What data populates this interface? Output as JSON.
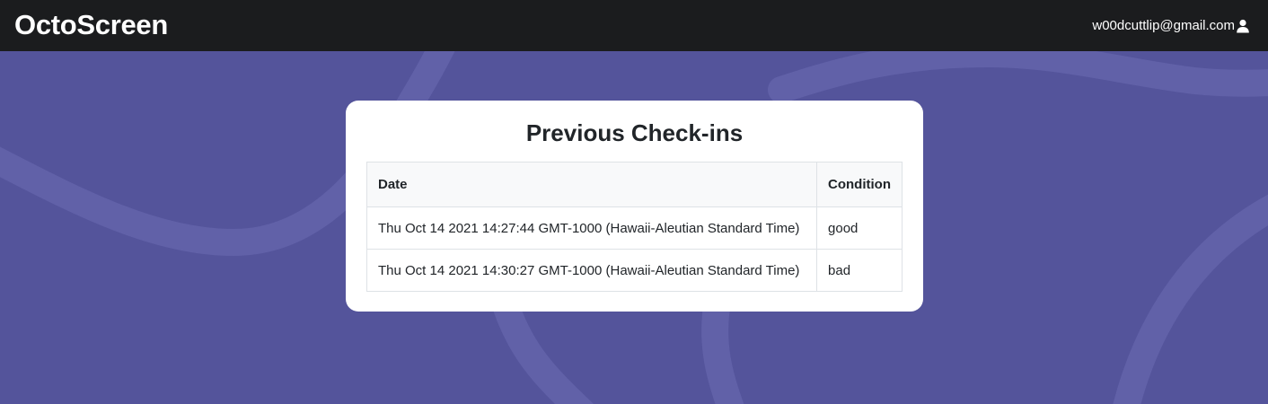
{
  "app": {
    "brand": "OctoScreen",
    "user_email": "w00dcuttlip@gmail.com",
    "user_icon": "user-icon"
  },
  "colors": {
    "background": "#54549b",
    "wave": "#6262a8",
    "navbar": "#1b1c1e",
    "card": "#ffffff",
    "table_header": "#f8f9fa",
    "border": "#dee2e6"
  },
  "checkins": {
    "title": "Previous Check-ins",
    "columns": [
      "Date",
      "Condition"
    ],
    "rows": [
      {
        "date": "Thu Oct 14 2021 14:27:44 GMT-1000 (Hawaii-Aleutian Standard Time)",
        "condition": "good"
      },
      {
        "date": "Thu Oct 14 2021 14:30:27 GMT-1000 (Hawaii-Aleutian Standard Time)",
        "condition": "bad"
      }
    ]
  }
}
